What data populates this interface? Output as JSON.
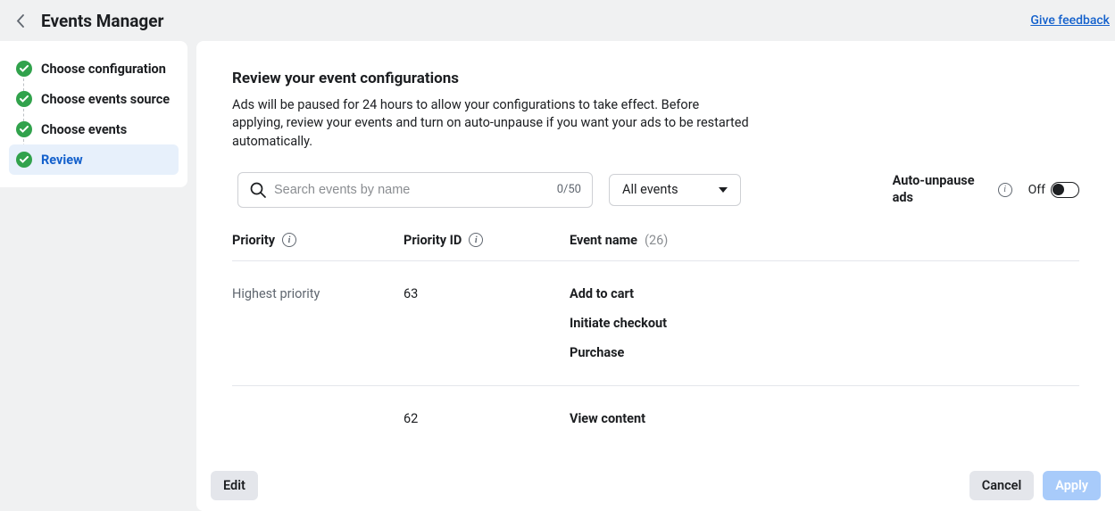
{
  "header": {
    "title": "Events Manager",
    "feedback": "Give feedback"
  },
  "sidebar": {
    "steps": [
      {
        "label": "Choose configuration",
        "done": true,
        "active": false
      },
      {
        "label": "Choose events source",
        "done": true,
        "active": false
      },
      {
        "label": "Choose events",
        "done": true,
        "active": false
      },
      {
        "label": "Review",
        "done": true,
        "active": true
      }
    ]
  },
  "main": {
    "heading": "Review your event configurations",
    "description": "Ads will be paused for 24 hours to allow your configurations to take effect. Before applying, review your events and turn on auto-unpause if you want your ads to be restarted automatically.",
    "search": {
      "placeholder": "Search events by name",
      "count": "0/50"
    },
    "filter": {
      "selected": "All events"
    },
    "auto_unpause": {
      "label": "Auto-unpause ads",
      "state_text": "Off"
    },
    "columns": {
      "priority": "Priority",
      "priority_id": "Priority ID",
      "event_name": "Event name",
      "event_count": "(26)"
    },
    "rows": [
      {
        "priority": "Highest priority",
        "priority_id": "63",
        "events": [
          "Add to cart",
          "Initiate checkout",
          "Purchase"
        ]
      },
      {
        "priority": "",
        "priority_id": "62",
        "events": [
          "View content"
        ]
      }
    ]
  },
  "footer": {
    "edit": "Edit",
    "cancel": "Cancel",
    "apply": "Apply"
  }
}
